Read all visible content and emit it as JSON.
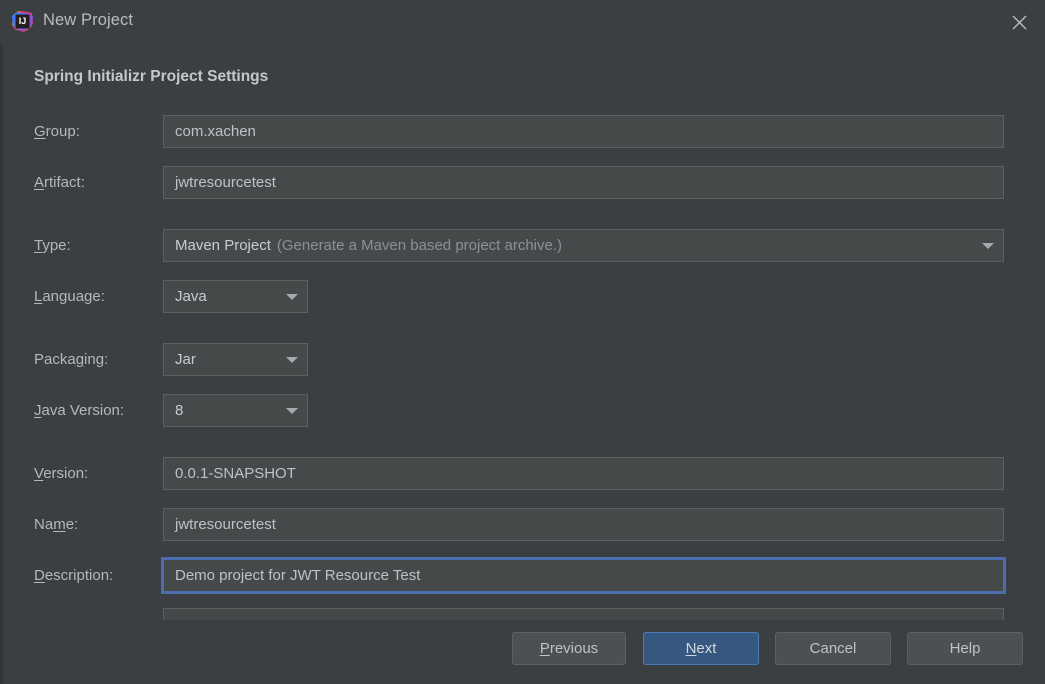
{
  "window": {
    "title": "New Project",
    "logo_icon": "intellij-idea-logo-icon",
    "logo_text": "IJ",
    "close_icon": "close-icon"
  },
  "colors": {
    "dialog_background": "#3c3f41",
    "field_background": "#45494a",
    "field_border": "#5e6060",
    "focus_blue": "#4b6eaf",
    "default_button_blue": "#365880",
    "text_primary": "#bfc2c4",
    "text_secondary": "#8d9093",
    "heading": "#c5c7c9"
  },
  "section": {
    "heading": "Spring Initializr Project Settings"
  },
  "form": {
    "group": {
      "label_before": "",
      "label_mnemonic": "G",
      "label_after": "roup:",
      "value": "com.xachen"
    },
    "artifact": {
      "label_before": "",
      "label_mnemonic": "A",
      "label_after": "rtifact:",
      "value": "jwtresourcetest"
    },
    "type": {
      "label_before": "",
      "label_mnemonic": "T",
      "label_after": "ype:",
      "value": "Maven Project",
      "hint": "(Generate a Maven based project archive.)",
      "arrow_icon": "chevron-down-icon"
    },
    "language": {
      "label_before": "",
      "label_mnemonic": "L",
      "label_after": "anguage:",
      "value": "Java",
      "arrow_icon": "chevron-down-icon"
    },
    "packaging": {
      "label_before": "Packa",
      "label_mnemonic": "g",
      "label_after": "ing:",
      "value": "Jar",
      "arrow_icon": "chevron-down-icon"
    },
    "java_version": {
      "label_before": "",
      "label_mnemonic": "J",
      "label_after": "ava Version:",
      "value": "8",
      "arrow_icon": "chevron-down-icon"
    },
    "version": {
      "label_before": "",
      "label_mnemonic": "V",
      "label_after": "ersion:",
      "value": "0.0.1-SNAPSHOT"
    },
    "name": {
      "label_before": "Na",
      "label_mnemonic": "m",
      "label_after": "e:",
      "value": "jwtresourcetest"
    },
    "description": {
      "label_before": "",
      "label_mnemonic": "D",
      "label_after": "escription:",
      "value": "Demo project for JWT Resource Test",
      "focused": true
    }
  },
  "buttons": {
    "previous": {
      "before": "",
      "mnemonic": "P",
      "after": "revious"
    },
    "next": {
      "before": "",
      "mnemonic": "N",
      "after": "ext",
      "is_default": true
    },
    "cancel": {
      "before": "Cancel",
      "mnemonic": "",
      "after": ""
    },
    "help": {
      "before": "Help",
      "mnemonic": "",
      "after": ""
    }
  }
}
